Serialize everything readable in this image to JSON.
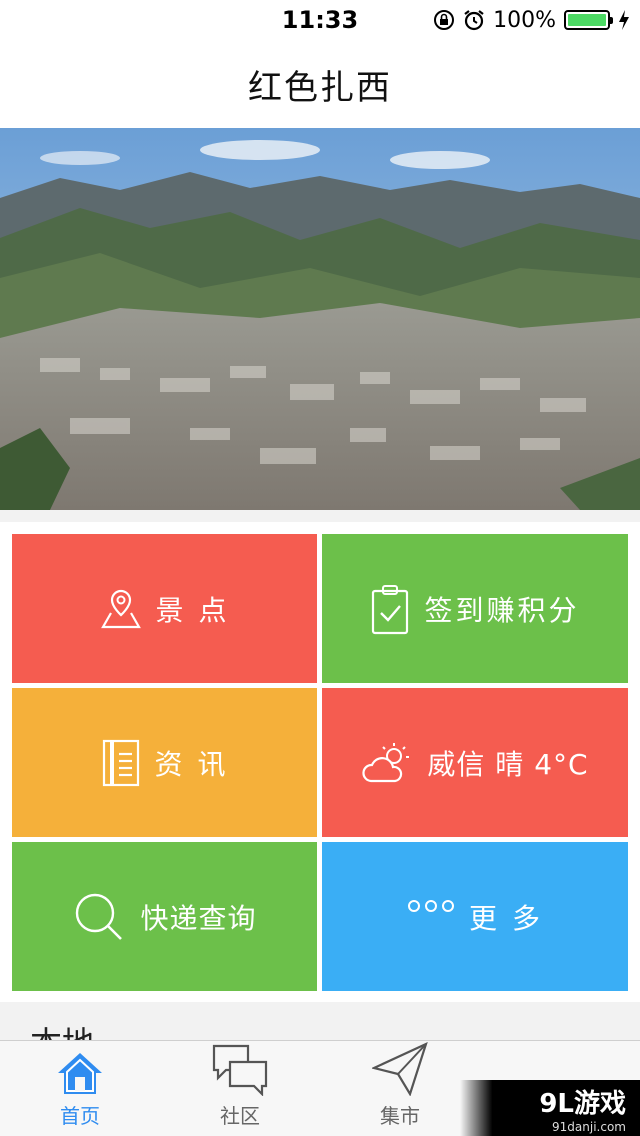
{
  "status_bar": {
    "time": "11:33",
    "battery_percent_label": "100%",
    "battery_level": 1.0
  },
  "nav": {
    "title": "红色扎西"
  },
  "tiles": [
    {
      "label": "景 点",
      "icon": "map-pin-icon",
      "color": "#f55c50"
    },
    {
      "label": "签到赚积分",
      "icon": "clipboard-check-icon",
      "color": "#6cc04a"
    },
    {
      "label": "资 讯",
      "icon": "document-icon",
      "color": "#f5b03a"
    },
    {
      "label": "威信 晴 4°C",
      "icon": "partly-cloudy-icon",
      "color": "#f55c50"
    },
    {
      "label": "快递查询",
      "icon": "search-icon",
      "color": "#6cc04a"
    },
    {
      "label": "更 多",
      "icon": "more-dots-icon",
      "color": "#3aaef5"
    }
  ],
  "section": {
    "title": "本地"
  },
  "tab_bar": {
    "tabs": [
      {
        "label": "首页",
        "icon": "home-icon",
        "active": true
      },
      {
        "label": "社区",
        "icon": "chat-bubbles-icon",
        "active": false
      },
      {
        "label": "集市",
        "icon": "paper-plane-icon",
        "active": false
      },
      {
        "label": "",
        "icon": "person-icon",
        "active": false
      }
    ]
  },
  "watermark": {
    "main": "9L游戏",
    "sub": "91danji.com"
  },
  "colors": {
    "accent": "#2f8cf0",
    "red": "#f55c50",
    "green": "#6cc04a",
    "orange": "#f5b03a",
    "blue": "#3aaef5"
  }
}
